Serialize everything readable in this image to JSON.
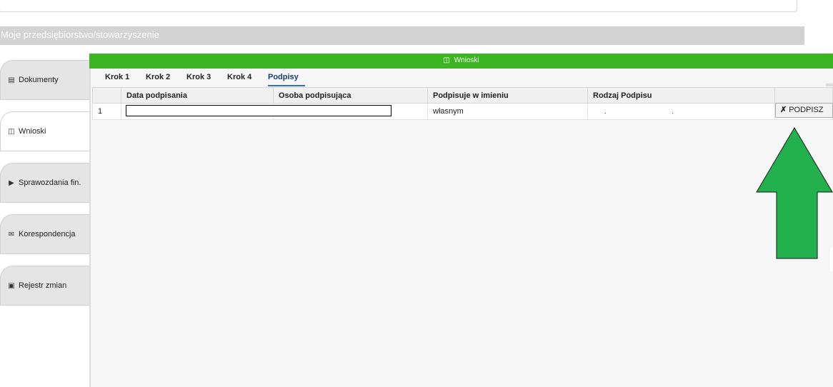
{
  "section": {
    "title": "Moje przedsiębiorstwo/stowarzyszenie"
  },
  "sidebar": {
    "items": [
      {
        "label": "Dokumenty",
        "icon": "document-icon",
        "active": false
      },
      {
        "label": "Wnioski",
        "icon": "file-icon",
        "active": true
      },
      {
        "label": "Sprawozdania fin.",
        "icon": "folder-open-icon",
        "active": false
      },
      {
        "label": "Korespondencja",
        "icon": "envelope-icon",
        "active": false
      },
      {
        "label": "Rejestr zmian",
        "icon": "briefcase-icon",
        "active": false
      }
    ]
  },
  "panel": {
    "title": "Wnioski",
    "header_color": "#3bb521"
  },
  "steps": [
    {
      "label": "Krok 1",
      "active": false
    },
    {
      "label": "Krok 2",
      "active": false
    },
    {
      "label": "Krok 3",
      "active": false
    },
    {
      "label": "Krok 4",
      "active": false
    },
    {
      "label": "Podpisy",
      "active": true
    }
  ],
  "table": {
    "headers": [
      "",
      "Data podpisania",
      "Osoba podpisująca",
      "Podpisuje w imieniu",
      "Rodzaj Podpisu",
      ""
    ],
    "rows": [
      {
        "index": "1",
        "date": "",
        "signer": "",
        "on_behalf": "własnym",
        "signature_type": "",
        "action_label": "PODPISZ"
      }
    ]
  },
  "arrow": {
    "fill": "#22b14c",
    "icon": "arrow-up-icon"
  }
}
